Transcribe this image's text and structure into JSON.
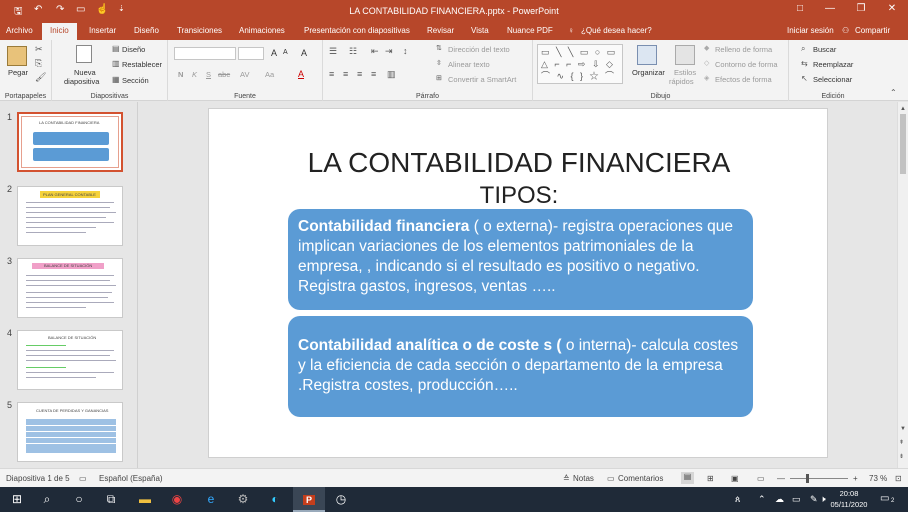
{
  "window": {
    "title": "LA CONTABILIDAD FINANCIERA.pptx  -  PowerPoint",
    "controls": [
      "□",
      "—",
      "❐",
      "✕"
    ]
  },
  "tabs": {
    "archivo": "Archivo",
    "inicio": "Inicio",
    "insertar": "Insertar",
    "diseno": "Diseño",
    "transiciones": "Transiciones",
    "animaciones": "Animaciones",
    "presentacion": "Presentación con diapositivas",
    "revisar": "Revisar",
    "vista": "Vista",
    "nuance": "Nuance PDF",
    "tellme": "¿Qué desea hacer?",
    "signin": "Iniciar sesión",
    "share": "Compartir"
  },
  "ribbon": {
    "portapapeles": {
      "label": "Portapapeles",
      "pegar": "Pegar"
    },
    "diapositivas": {
      "label": "Diapositivas",
      "nueva": "Nueva",
      "nueva2": "diapositiva",
      "diseno": "Diseño",
      "restablecer": "Restablecer",
      "seccion": "Sección"
    },
    "fuente": {
      "label": "Fuente",
      "bold": "N",
      "italic": "K",
      "underline": "S",
      "strike": "abc",
      "spacing": "AV",
      "case": "Aa",
      "grow": "A",
      "shrink": "A",
      "clear": "A"
    },
    "parrafo": {
      "label": "Párrafo",
      "direccion": "Dirección del texto",
      "alinear": "Alinear texto",
      "smartart": "Convertir a SmartArt"
    },
    "dibujo": {
      "label": "Dibujo",
      "organizar": "Organizar",
      "estilos": "Estilos",
      "estilos2": "rápidos",
      "relleno": "Relleno de forma",
      "contorno": "Contorno de forma",
      "efectos": "Efectos de forma"
    },
    "edicion": {
      "label": "Edición",
      "buscar": "Buscar",
      "reemplazar": "Reemplazar",
      "seleccionar": "Seleccionar"
    }
  },
  "thumbnails": [
    {
      "num": "1",
      "title": "LA CONTABILIDAD FINANCIERA"
    },
    {
      "num": "2",
      "title": "PLAN GENERAL CONTABLE"
    },
    {
      "num": "3",
      "title": "BALANCE DE SITUACIÓN"
    },
    {
      "num": "4",
      "title": "BALANCE DE SITUACIÓN"
    },
    {
      "num": "5",
      "title": "CUENTA DE PERDIDAS Y GANANCIAS"
    }
  ],
  "slide": {
    "title": "LA CONTABILIDAD FINANCIERA",
    "subtitle": "TIPOS:",
    "box1_bold": "Contabilidad financiera",
    "box1_text": " ( o externa)- registra operaciones que implican variaciones de los elementos patrimoniales de la empresa, , indicando si el resultado es positivo o negativo. Registra  gastos,  ingresos, ventas …..",
    "box2_bold": "Contabilidad analítica o de coste s (",
    "box2_text": " o interna)- calcula costes y la eficiencia de cada sección o departamento de la empresa .Registra costes, producción…..",
    "box_color": "#5b9bd5"
  },
  "status": {
    "slide_info": "Diapositiva 1 de 5",
    "language": "Español (España)",
    "notes": "Notas",
    "comments": "Comentarios",
    "zoom": "73 %"
  },
  "taskbar": {
    "time": "20:08",
    "date": "05/11/2020",
    "notification_count": "2"
  },
  "colors": {
    "accent": "#b7472a",
    "taskbar": "#1f2a38"
  }
}
